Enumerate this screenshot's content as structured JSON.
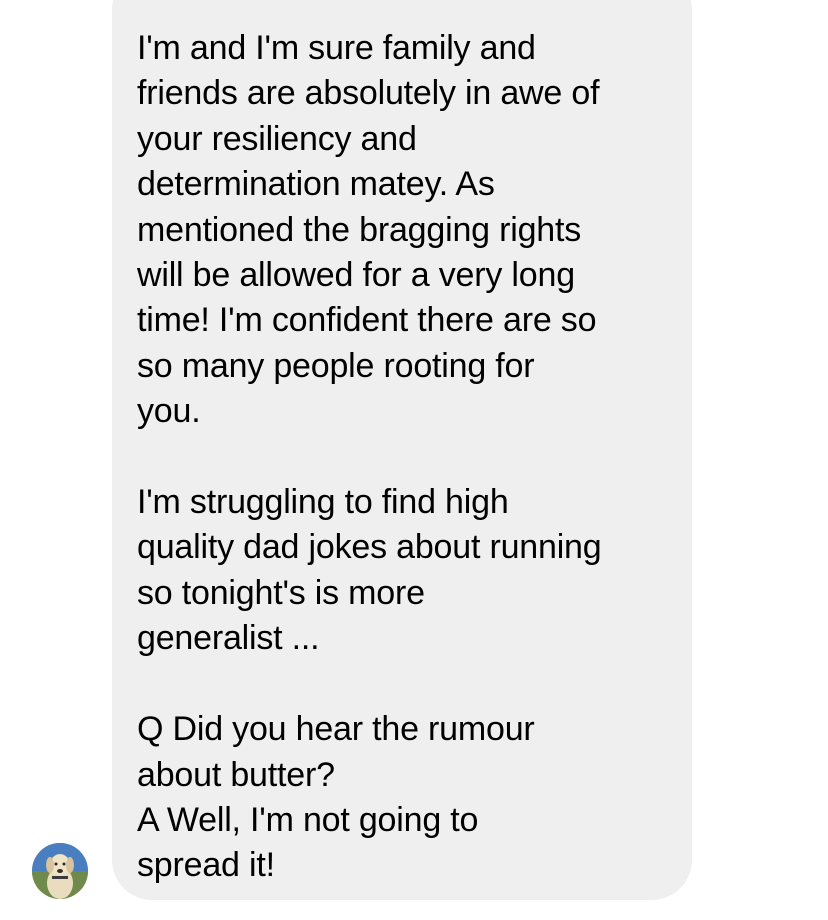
{
  "conversation": {
    "message": {
      "text": "I'm and I'm sure family and\nfriends are absolutely in awe of\nyour resiliency and\ndetermination matey. As\nmentioned the bragging rights\nwill be allowed for a very long\ntime! I'm confident there are so\nso many people rooting for\nyou.\n\nI'm struggling to find high\nquality dad jokes about running\nso tonight's is more\ngeneralist  ...\n\nQ Did you hear the rumour\nabout butter?\nA Well, I'm not going to\nspread it!",
      "bubble_color": "#efeff0",
      "text_color": "#000000"
    },
    "sender": {
      "avatar_icon": "dog-avatar-icon"
    }
  }
}
